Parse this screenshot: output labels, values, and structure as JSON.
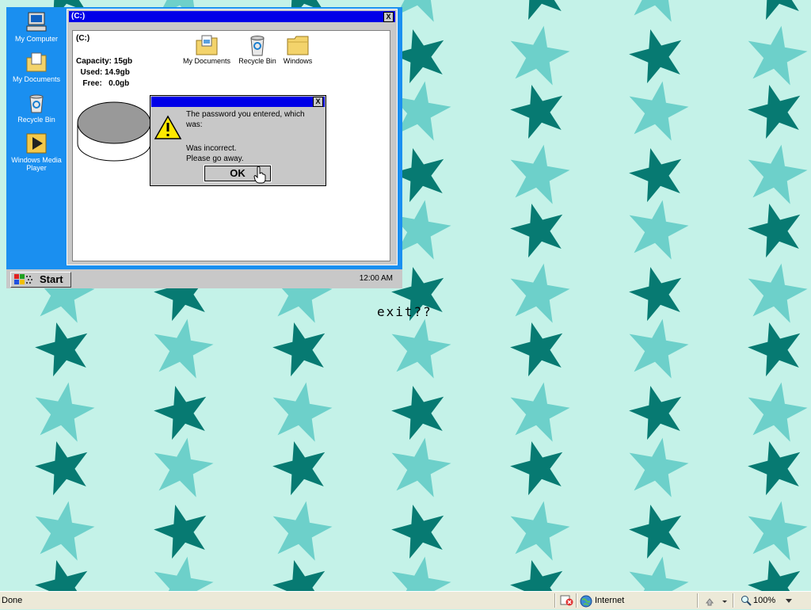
{
  "desktop": {
    "icons": [
      {
        "label": "My Computer",
        "icon": "my-computer-icon"
      },
      {
        "label": "My Documents",
        "icon": "my-documents-icon"
      },
      {
        "label": "Recycle Bin",
        "icon": "recycle-bin-icon"
      },
      {
        "label": "Windows Media Player",
        "icon": "media-player-icon"
      }
    ]
  },
  "explorer": {
    "title": "(C:)",
    "close": "X",
    "drive_label": "(C:)",
    "capacity": "Capacity: 15gb",
    "used": "  Used: 14.9gb",
    "free": "   Free:   0.0gb",
    "folders": [
      {
        "label": "My Documents",
        "icon": "documents-folder-icon"
      },
      {
        "label": "Recycle Bin",
        "icon": "recycle-bin-icon"
      },
      {
        "label": "Windows",
        "icon": "folder-icon"
      }
    ]
  },
  "dialog": {
    "close": "X",
    "line1": "The password you entered, which was:",
    "line2": "Was incorrect.",
    "line3": "Please go away.",
    "ok": "OK"
  },
  "taskbar": {
    "start": "Start",
    "clock": "12:00 AM"
  },
  "page_text": "exit??",
  "statusbar": {
    "status": "Done",
    "zone": "Internet",
    "zoom": "100%"
  },
  "colors": {
    "wallpaper_bg": "#c4f2e8",
    "star_light": "#6dd0ca",
    "star_dark": "#077a72",
    "sim_desktop": "#1a8ff0",
    "title_blue": "#0000e8"
  }
}
